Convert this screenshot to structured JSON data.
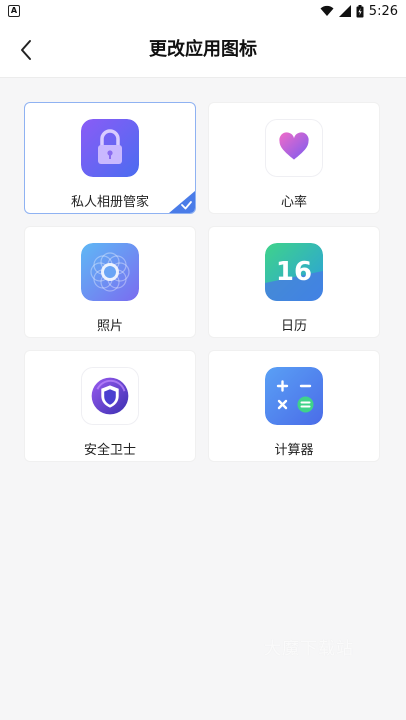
{
  "status_bar": {
    "time": "5:26",
    "notification_icon": "a-square-icon",
    "icons": [
      "wifi-icon",
      "signal-icon",
      "battery-icon"
    ]
  },
  "header": {
    "back_icon": "chevron-left-icon",
    "title": "更改应用图标"
  },
  "icons": [
    {
      "label": "私人相册管家",
      "icon": "lock-icon",
      "selected": true
    },
    {
      "label": "心率",
      "icon": "heart-icon",
      "selected": false
    },
    {
      "label": "照片",
      "icon": "photo-flower-icon",
      "selected": false
    },
    {
      "label": "日历",
      "icon": "calendar-icon",
      "calendar_day": "16",
      "selected": false
    },
    {
      "label": "安全卫士",
      "icon": "shield-icon",
      "selected": false
    },
    {
      "label": "计算器",
      "icon": "calculator-icon",
      "selected": false
    }
  ],
  "watermark": "大魔下载站",
  "colors": {
    "background": "#f6f6f7",
    "selected_border": "#8fb2f2",
    "check_badge": "#4a7ce8"
  }
}
